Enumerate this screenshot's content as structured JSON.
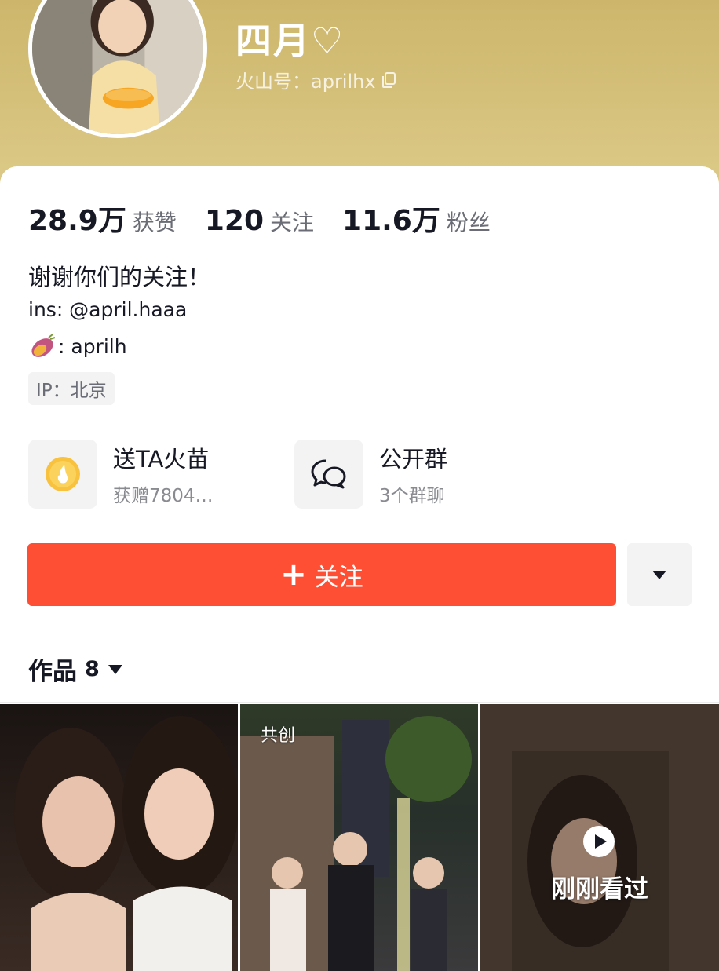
{
  "profile": {
    "nickname": "四月♡",
    "id_line": "火山号：aprilhx"
  },
  "stats": [
    {
      "value": "28.9万",
      "label": "获赞"
    },
    {
      "value": "120",
      "label": "关注"
    },
    {
      "value": "11.6万",
      "label": "粉丝"
    }
  ],
  "bio": {
    "line1": "谢谢你们的关注！",
    "line2": "ins: @april.haaa",
    "line3": ": aprilh",
    "ip": "IP：北京"
  },
  "features": [
    {
      "title": "送TA火苗",
      "subtitle": "获赠7804…",
      "icon": "flame-coin-icon"
    },
    {
      "title": "公开群",
      "subtitle": "3个群聊",
      "icon": "chat-bubbles-icon"
    }
  ],
  "actions": {
    "follow_label": "关注",
    "follow_color": "#fe4f35"
  },
  "works": {
    "label": "作品",
    "count": "8"
  },
  "tiles": [
    {
      "tag": ""
    },
    {
      "tag": "共创"
    },
    {
      "tag": "",
      "overlay": "刚刚看过"
    }
  ],
  "colors": {
    "header_gold": "#cdb66c",
    "accent_red": "#fe4f35"
  }
}
